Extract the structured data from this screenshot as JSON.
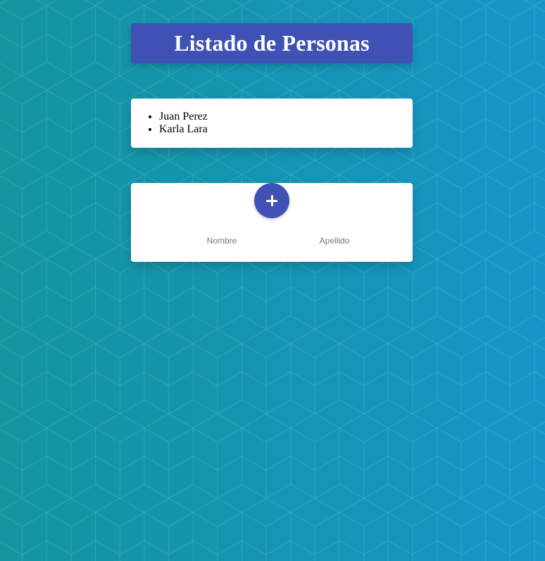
{
  "page": {
    "background_colors": [
      "#14959f",
      "#1795c8"
    ],
    "pattern": "isometric-cubes"
  },
  "header": {
    "title": "Listado de Personas",
    "color": "#3f51b5"
  },
  "personas": {
    "items": [
      "Juan Perez",
      "Karla Lara"
    ]
  },
  "form": {
    "add_button_icon": "plus-icon",
    "nombre": {
      "placeholder": "Nombre",
      "value": ""
    },
    "apellido": {
      "placeholder": "Apellido",
      "value": ""
    }
  }
}
